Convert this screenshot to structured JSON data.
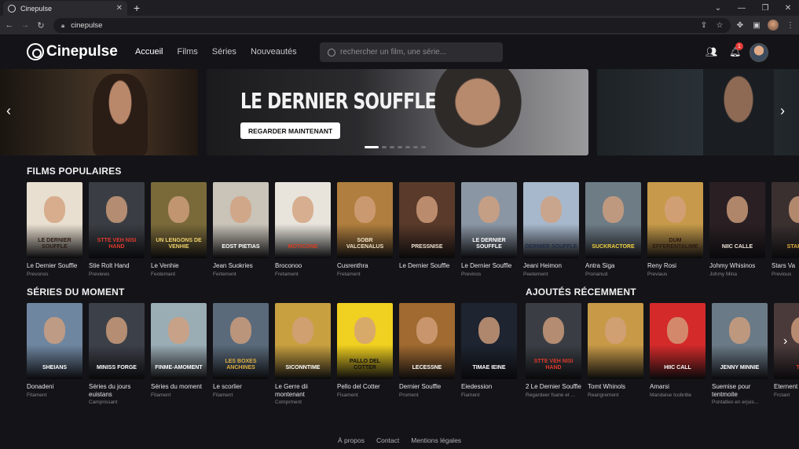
{
  "browser": {
    "tab_title": "Cinepulse",
    "tab_close": "✕",
    "new_tab": "+",
    "url": "cinepulse",
    "controls": {
      "chevron": "⌄",
      "minimize": "—",
      "restore": "❐",
      "close": "✕"
    }
  },
  "header": {
    "logo": "Cinepulse",
    "nav": [
      "Accueil",
      "Films",
      "Séries",
      "Nouveautés"
    ],
    "search_placeholder": "rechercher un film, une série...",
    "notification_count": "1"
  },
  "hero": {
    "title": "LE DERNIER SOUFFLE",
    "button": "REGARDER MAINTENANT",
    "dots": 7,
    "active_dot": 0
  },
  "sections": {
    "films_title": "FILMS POPULAIRES",
    "series_title": "SÉRIES DU MOMENT",
    "recent_title": "AJOUTÉS RÉCEMMENT"
  },
  "films": [
    {
      "title": "Le Dernier Souffle",
      "sub": "Prevonos",
      "poster_text": "LE DERNIER SOUFFLE",
      "bg": "#e9dfd0",
      "fg": "#2a1a12"
    },
    {
      "title": "Stie Rolt Hand",
      "sub": "Previews",
      "poster_text": "STTE VEH NISI HAND",
      "bg": "#3a3e44",
      "fg": "#e03a2c"
    },
    {
      "title": "Le Venhie",
      "sub": "Feotemant",
      "poster_text": "UN LENGONS DE VENHIE",
      "bg": "#7a6a3a",
      "fg": "#f1d36a"
    },
    {
      "title": "Jean Suokries",
      "sub": "Fertement",
      "poster_text": "EOST PIETIAS",
      "bg": "#c9c3b8",
      "fg": "#ffffff"
    },
    {
      "title": "Broconoo",
      "sub": "Fretament",
      "poster_text": "MOTICONE",
      "bg": "#e8e4dc",
      "fg": "#d83d22"
    },
    {
      "title": "Cusrenthra",
      "sub": "Fretament",
      "poster_text": "SOBR VALCENALUS",
      "bg": "#b07e3e",
      "fg": "#f3e4c4"
    },
    {
      "title": "Le Dernier Souffle",
      "sub": "",
      "poster_text": "PRESSNISE",
      "bg": "#5a3a2a",
      "fg": "#f0e0d0"
    },
    {
      "title": "Le Dernier Souffle",
      "sub": "Previnos",
      "poster_text": "LE DERNIER SOUFFLE",
      "bg": "#8a96a4",
      "fg": "#ffffff"
    },
    {
      "title": "Jeani Heimon",
      "sub": "Peetement",
      "poster_text": "DERNIER SOUFFLE",
      "bg": "#a7b8cc",
      "fg": "#1c2b45"
    },
    {
      "title": "Antra Siga",
      "sub": "Pronanud",
      "poster_text": "SUCKRACTORE",
      "bg": "#6e7c86",
      "fg": "#f0d040"
    },
    {
      "title": "Reny Rosi",
      "sub": "Previaus",
      "poster_text": "DUM EFFERENTALIME",
      "bg": "#c69a4a",
      "fg": "#2a1a10"
    },
    {
      "title": "Johmy Whisinos",
      "sub": "Johmy Mina",
      "poster_text": "NIIC CALLE",
      "bg": "#2a2024",
      "fg": "#f0e6da"
    },
    {
      "title": "Stars Va",
      "sub": "Previous",
      "poster_text": "STAR WA",
      "bg": "#3a3030",
      "fg": "#e0b040"
    }
  ],
  "series": [
    {
      "title": "Donadeni",
      "sub": "Fitament",
      "poster_text": "SHEIANS",
      "bg": "#6f86a0",
      "fg": "#ffffff"
    },
    {
      "title": "Séries du jours euistans",
      "sub": "Camprissant",
      "poster_text": "MINISS FORGE",
      "bg": "#3c4048",
      "fg": "#ffffff"
    },
    {
      "title": "Séries du moment",
      "sub": "Fitament",
      "poster_text": "FINME-AMOMENT",
      "bg": "#9aacb4",
      "fg": "#ffffff"
    },
    {
      "title": "Le scorlier",
      "sub": "Fitament",
      "poster_text": "LES BOXES ANCHINES",
      "bg": "#5a6a7a",
      "fg": "#e0b040"
    },
    {
      "title": "Le Gerre dii montenant",
      "sub": "Comprment",
      "poster_text": "SICONNTIME",
      "bg": "#c8a040",
      "fg": "#ffffff"
    },
    {
      "title": "Pello del Cotter",
      "sub": "Fisament",
      "poster_text": "PALLO DEL COTTER",
      "bg": "#f0d020",
      "fg": "#111111"
    },
    {
      "title": "Dernier Souffle",
      "sub": "Proment",
      "poster_text": "LECESSNE",
      "bg": "#a06a30",
      "fg": "#ffffff"
    },
    {
      "title": "Eiedession",
      "sub": "Fiament",
      "poster_text": "TIMAE IEINE",
      "bg": "#1e2430",
      "fg": "#ffffff"
    }
  ],
  "recent": [
    {
      "title": "2 Le Dernier Souffle",
      "sub": "Regardeer fsane et ...",
      "poster_text": "STTE VEH NISI HAND",
      "bg": "#3a3e44",
      "fg": "#e03a2c"
    },
    {
      "title": "Tomt Whinols",
      "sub": "Reangrement",
      "poster_text": "",
      "bg": "#c89a48",
      "fg": "#ffffff"
    },
    {
      "title": "Amarsi",
      "sub": "Mandaise Icobritte",
      "poster_text": "HIIC CALL",
      "bg": "#d42a2a",
      "fg": "#ffffff"
    },
    {
      "title": "Suemise pour tentmoite",
      "sub": "Pontatleo en erjuis...",
      "poster_text": "JENNY MINNIE",
      "bg": "#6a7a86",
      "fg": "#ffffff"
    },
    {
      "title": "Eternent",
      "sub": "Frctant",
      "poster_text": "THE",
      "bg": "#4a3a3a",
      "fg": "#e03a2c"
    }
  ],
  "footer": [
    "À propos",
    "Contact",
    "Mentions légales"
  ]
}
